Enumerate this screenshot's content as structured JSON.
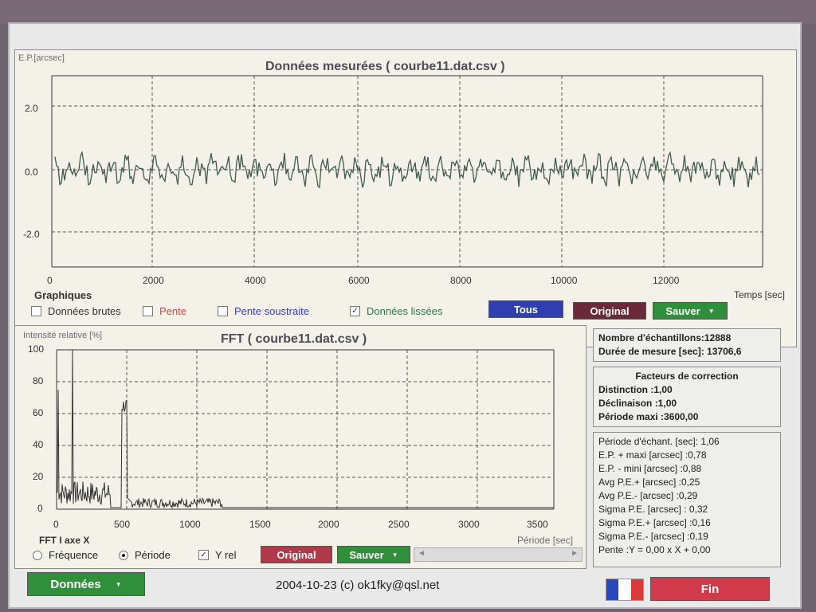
{
  "top_chart": {
    "title": "Données mesurées ( courbe11.dat.csv )",
    "ylabel": "E.P.[arcsec]",
    "xlabel": "Temps [sec]",
    "yticks": [
      "2.0",
      "0.0",
      "-2.0"
    ],
    "xticks": [
      "0",
      "2000",
      "4000",
      "6000",
      "8000",
      "10000",
      "12000"
    ]
  },
  "graphiques": {
    "label": "Graphiques",
    "checkboxes": [
      {
        "label": "Données brutes",
        "checked": false,
        "color": "#333333"
      },
      {
        "label": "Pente",
        "checked": false,
        "color": "#d04a4a"
      },
      {
        "label": "Pente soustraite",
        "checked": false,
        "color": "#3a3ad0"
      },
      {
        "label": "Données lissées",
        "checked": true,
        "color": "#2a7a4a"
      }
    ],
    "btn_tous": "Tous",
    "btn_original": "Original",
    "btn_sauver": "Sauver"
  },
  "fft_chart": {
    "title": "FFT ( courbe11.dat.csv )",
    "ylabel": "Intensité relative [%]",
    "xlabel": "Période [sec]",
    "yticks": [
      "100",
      "80",
      "60",
      "40",
      "20",
      "0"
    ],
    "xticks": [
      "0",
      "500",
      "1000",
      "1500",
      "2000",
      "2500",
      "3000",
      "3500"
    ]
  },
  "fft_controls": {
    "axis_label": "FFT I axe X",
    "radio_freq": "Fréquence",
    "radio_period": "Période",
    "yrel": "Y rel",
    "btn_original": "Original",
    "btn_sauver": "Sauver"
  },
  "info1": [
    "Nombre d'échantillons:12888",
    "Durée de mesure [sec]: 13706,6"
  ],
  "info2": {
    "title": "Facteurs de correction",
    "lines": [
      "Distinction :1,00",
      "Déclinaison :1,00",
      "Période maxi :3600,00"
    ]
  },
  "info3": [
    "Période d'échant. [sec]: 1,06",
    "E.P. + maxi [arcsec] :0,78",
    "E.P. - mini [arcsec] :0,88",
    "Avg P.E.+ [arcsec] :0,25",
    "Avg P.E.- [arcsec] :0,29",
    "Sigma P.E. [arcsec] : 0,32",
    "Sigma P.E.+ [arcsec] :0,16",
    "Sigma P.E.- [arcsec] :0,19",
    "Pente :Y = 0,00 x X + 0,00"
  ],
  "footer": {
    "btn_donnees": "Données",
    "copyright": "2004-10-23 (c) ok1fky@qsl.net",
    "btn_fin": "Fin"
  },
  "colors": {
    "blue_btn": "#2f3fb0",
    "maroon_btn": "#6a2a3a",
    "green_btn": "#2f8f3a",
    "red_btn": "#d03a4a",
    "trace": "#3f5a4f"
  }
}
